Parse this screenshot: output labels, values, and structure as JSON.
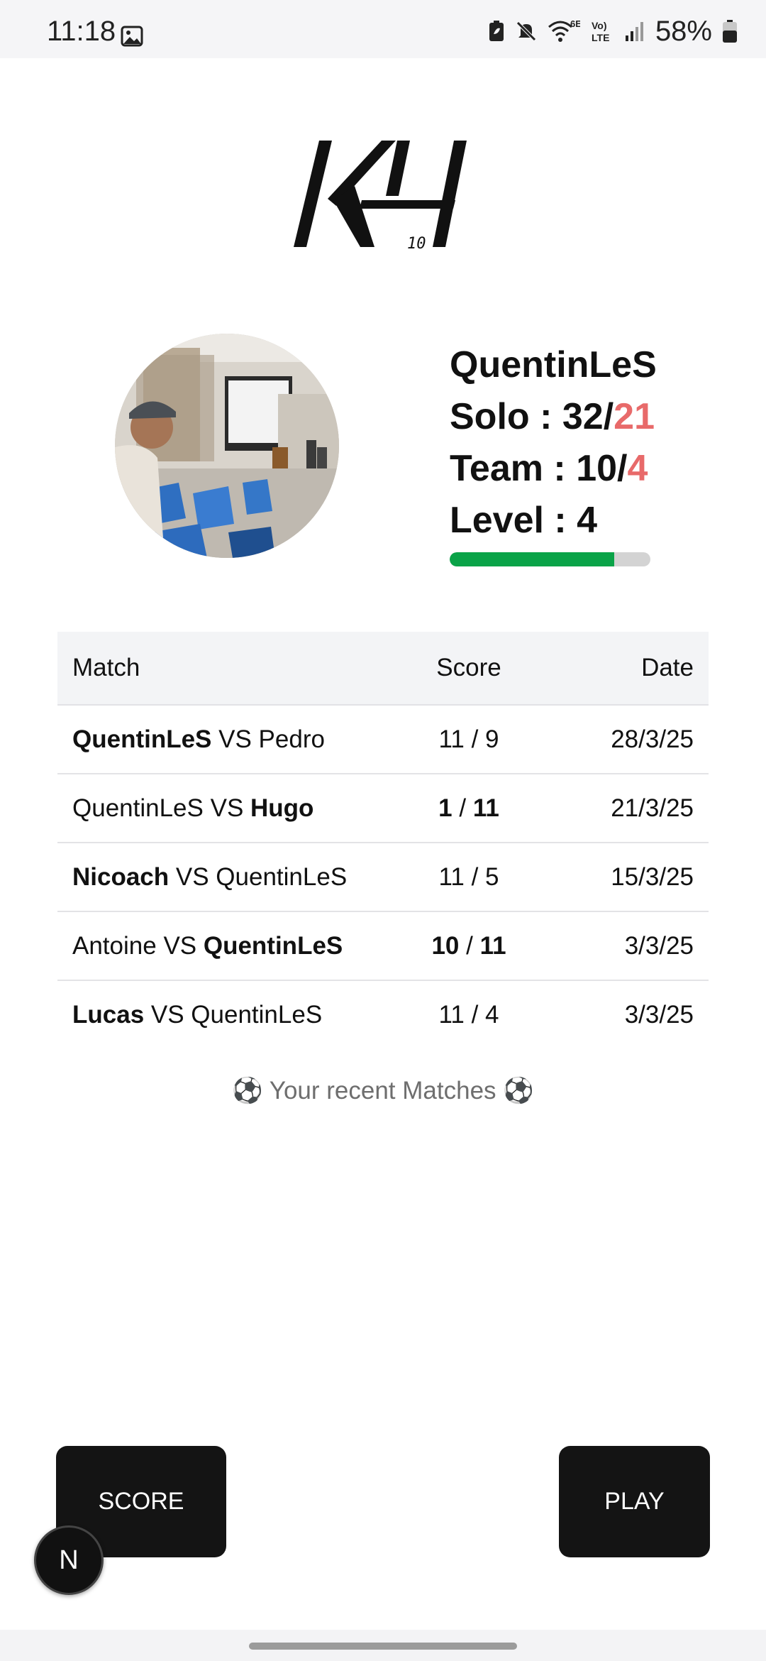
{
  "status_bar": {
    "time": "11:18",
    "battery_percent": "58%",
    "icons": [
      "gallery-icon",
      "battery-saver-icon",
      "mute-icon",
      "wifi-6e-icon",
      "volte-icon",
      "signal-icon",
      "battery-icon"
    ],
    "wifi_label": "6E",
    "volte_label": "Vo) LTE"
  },
  "logo": {
    "text": "KH",
    "subscript": "10"
  },
  "profile": {
    "username": "QuentinLeS",
    "solo_label": "Solo : 32/",
    "solo_losses": "21",
    "team_label": "Team : 10/",
    "team_losses": "4",
    "level_text": "Level : 4",
    "level_progress": 0.82,
    "colors": {
      "losses": "#e86a6a",
      "progress": "#0aa348"
    }
  },
  "matches": {
    "headers": {
      "match": "Match",
      "score": "Score",
      "date": "Date"
    },
    "rows": [
      {
        "p1": "QuentinLeS",
        "vs": " VS ",
        "p2": "Pedro",
        "s1": "11",
        "sep": " / ",
        "s2": "9",
        "date": "28/3/25"
      },
      {
        "p1": "QuentinLeS",
        "vs": " VS ",
        "p2": "Hugo",
        "s1": "1",
        "sep": " / ",
        "s2": "11",
        "date": "21/3/25"
      },
      {
        "p1": "Nicoach",
        "vs": " VS ",
        "p2": "QuentinLeS",
        "s1": "11",
        "sep": " / ",
        "s2": "5",
        "date": "15/3/25"
      },
      {
        "p1": "Antoine",
        "vs": " VS ",
        "p2": "QuentinLeS",
        "s1": "10",
        "sep": " / ",
        "s2": "11",
        "date": "3/3/25"
      },
      {
        "p1": "Lucas",
        "vs": " VS ",
        "p2": "QuentinLeS",
        "s1": "11",
        "sep": " / ",
        "s2": "4",
        "date": "3/3/25"
      }
    ],
    "caption": "⚽ Your recent Matches ⚽"
  },
  "actions": {
    "score_label": "SCORE",
    "play_label": "PLAY"
  },
  "dev_badge": {
    "letter": "N"
  }
}
